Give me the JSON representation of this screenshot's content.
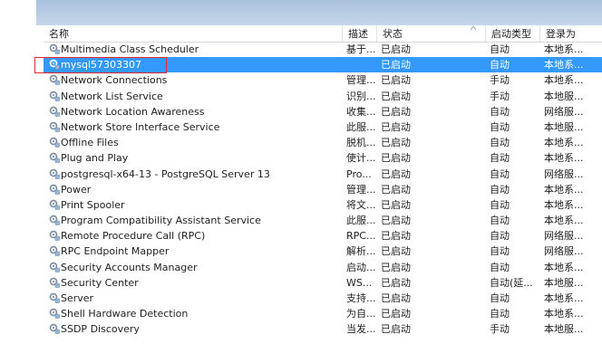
{
  "header": {
    "columns": [
      "名称",
      "描述",
      "状态",
      "启动类型",
      "登录为"
    ],
    "sorted_column": "状态"
  },
  "services": [
    {
      "name": "Multimedia Class Scheduler",
      "description": "基于...",
      "status": "已启动",
      "startup": "自动",
      "logon": "本地系..."
    },
    {
      "name": "mysql57303307",
      "description": "",
      "status": "已启动",
      "startup": "自动",
      "logon": "本地系...",
      "selected": true
    },
    {
      "name": "Network Connections",
      "description": "管理...",
      "status": "已启动",
      "startup": "手动",
      "logon": "本地系..."
    },
    {
      "name": "Network List Service",
      "description": "识别...",
      "status": "已启动",
      "startup": "手动",
      "logon": "本地服..."
    },
    {
      "name": "Network Location Awareness",
      "description": "收集...",
      "status": "已启动",
      "startup": "自动",
      "logon": "网络服..."
    },
    {
      "name": "Network Store Interface Service",
      "description": "此服...",
      "status": "已启动",
      "startup": "自动",
      "logon": "本地服..."
    },
    {
      "name": "Offline Files",
      "description": "脱机...",
      "status": "已启动",
      "startup": "自动",
      "logon": "本地系..."
    },
    {
      "name": "Plug and Play",
      "description": "使计...",
      "status": "已启动",
      "startup": "自动",
      "logon": "本地系..."
    },
    {
      "name": "postgresql-x64-13 - PostgreSQL Server 13",
      "description": "Pro...",
      "status": "已启动",
      "startup": "自动",
      "logon": "网络服..."
    },
    {
      "name": "Power",
      "description": "管理...",
      "status": "已启动",
      "startup": "自动",
      "logon": "本地系..."
    },
    {
      "name": "Print Spooler",
      "description": "将文...",
      "status": "已启动",
      "startup": "自动",
      "logon": "本地系..."
    },
    {
      "name": "Program Compatibility Assistant Service",
      "description": "此服...",
      "status": "已启动",
      "startup": "自动",
      "logon": "本地系..."
    },
    {
      "name": "Remote Procedure Call (RPC)",
      "description": "RPC...",
      "status": "已启动",
      "startup": "自动",
      "logon": "网络服..."
    },
    {
      "name": "RPC Endpoint Mapper",
      "description": "解析...",
      "status": "已启动",
      "startup": "自动",
      "logon": "网络服..."
    },
    {
      "name": "Security Accounts Manager",
      "description": "启动...",
      "status": "已启动",
      "startup": "自动",
      "logon": "本地系..."
    },
    {
      "name": "Security Center",
      "description": "WS...",
      "status": "已启动",
      "startup": "自动(延...",
      "logon": "本地服..."
    },
    {
      "name": "Server",
      "description": "支持...",
      "status": "已启动",
      "startup": "自动",
      "logon": "本地系..."
    },
    {
      "name": "Shell Hardware Detection",
      "description": "为自...",
      "status": "已启动",
      "startup": "自动",
      "logon": "本地系..."
    },
    {
      "name": "SSDP Discovery",
      "description": "当发...",
      "status": "已启动",
      "startup": "手动",
      "logon": "本地服..."
    }
  ],
  "colors": {
    "selection": "#3399ff",
    "highlight_box": "#e8262c",
    "icon": "#7d8fa5"
  },
  "icon": "gear-service-icon"
}
